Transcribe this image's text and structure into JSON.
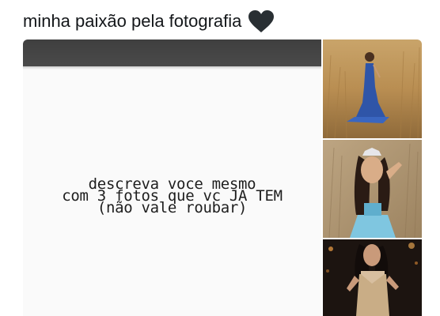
{
  "tweet": {
    "text": "minha paixão pela fotografia",
    "emoji_icon": "black-heart-icon",
    "heart_color": "#292f33"
  },
  "media": {
    "main_photo": {
      "lines": [
        "descreva voce mesmo",
        "com 3 fotos que vc JA TEM",
        "(não vale roubar)"
      ]
    },
    "thumbnails": [
      {
        "subject": "woman-blue-gown-field-photo"
      },
      {
        "subject": "woman-tiara-field-photo"
      },
      {
        "subject": "woman-sequin-dress-night-photo"
      }
    ]
  }
}
